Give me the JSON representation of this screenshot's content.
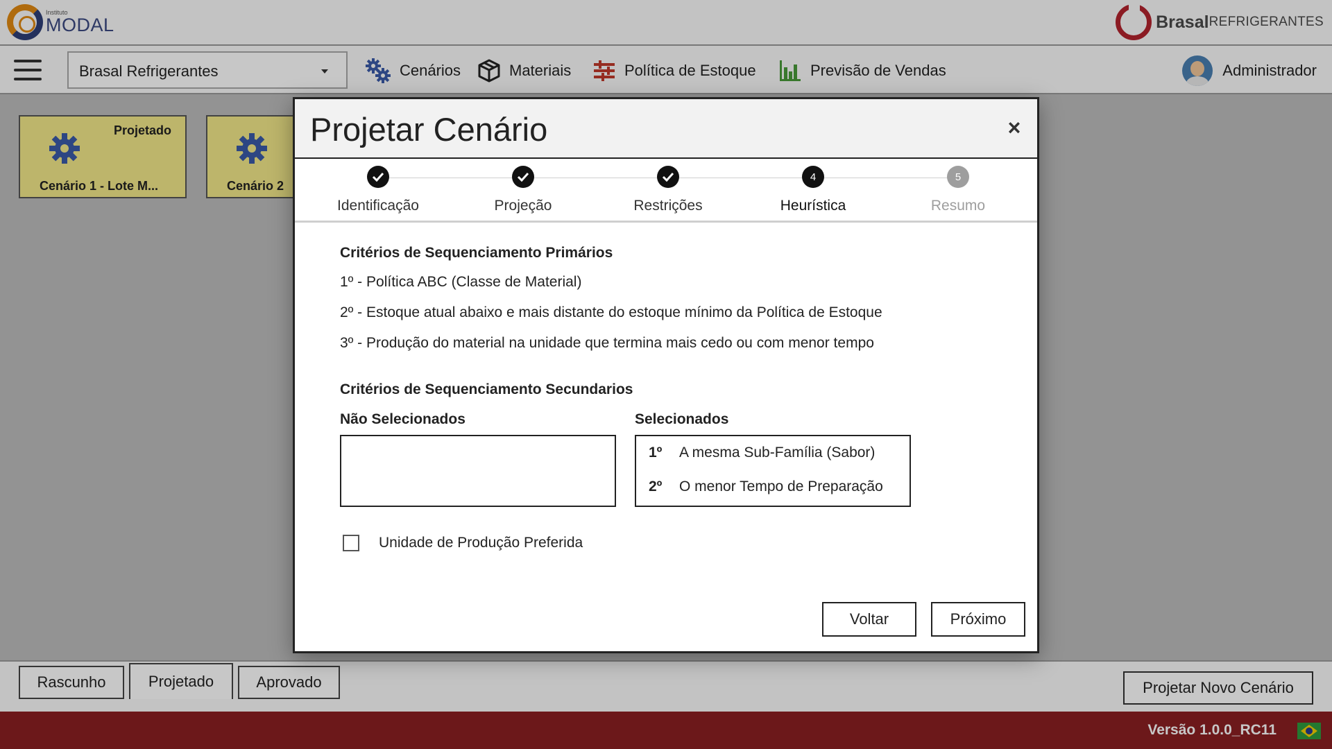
{
  "header": {
    "left_logo": {
      "small": "Instituto",
      "name": "MODAL"
    },
    "right_logo": {
      "name": "Brasal",
      "sub": "REFRIGERANTES"
    }
  },
  "navbar": {
    "company": "Brasal Refrigerantes",
    "items": [
      {
        "label": "Cenários",
        "icon": "gears-icon"
      },
      {
        "label": "Materiais",
        "icon": "box-icon"
      },
      {
        "label": "Política de Estoque",
        "icon": "stock-policy-icon"
      },
      {
        "label": "Previsão de Vendas",
        "icon": "bar-chart-icon"
      }
    ],
    "user": "Administrador"
  },
  "cards": [
    {
      "status": "Projetado",
      "title": "Cenário 1 - Lote M..."
    },
    {
      "status": "",
      "title": "Cenário 2"
    }
  ],
  "bottom_tabs": {
    "tabs": [
      "Rascunho",
      "Projetado",
      "Aprovado"
    ],
    "active": "Projetado",
    "new_button": "Projetar Novo Cenário"
  },
  "footer": {
    "version": "Versão 1.0.0_RC11"
  },
  "modal": {
    "title": "Projetar Cenário",
    "close": "×",
    "steps": [
      {
        "label": "Identificação",
        "state": "done"
      },
      {
        "label": "Projeção",
        "state": "done"
      },
      {
        "label": "Restrições",
        "state": "done"
      },
      {
        "label": "Heurística",
        "state": "current",
        "number": "4"
      },
      {
        "label": "Resumo",
        "state": "pending",
        "number": "5"
      }
    ],
    "primary_title": "Critérios de Sequenciamento Primários",
    "primary_criteria": [
      "1º - Política ABC (Classe de Material)",
      "2º - Estoque atual abaixo e mais distante do estoque mínimo da Política de Estoque",
      "3º - Produção do material na unidade que termina mais cedo ou com menor tempo"
    ],
    "secondary_title": "Critérios de Sequenciamento Secundarios",
    "not_selected_title": "Não Selecionados",
    "not_selected_items": [],
    "selected_title": "Selecionados",
    "selected_items": [
      {
        "order": "1º",
        "label": "A mesma Sub-Família (Sabor)"
      },
      {
        "order": "2º",
        "label": "O menor Tempo de Preparação"
      }
    ],
    "checkbox_label": "Unidade de Produção Preferida",
    "checkbox_checked": false,
    "back_button": "Voltar",
    "next_button": "Próximo"
  }
}
